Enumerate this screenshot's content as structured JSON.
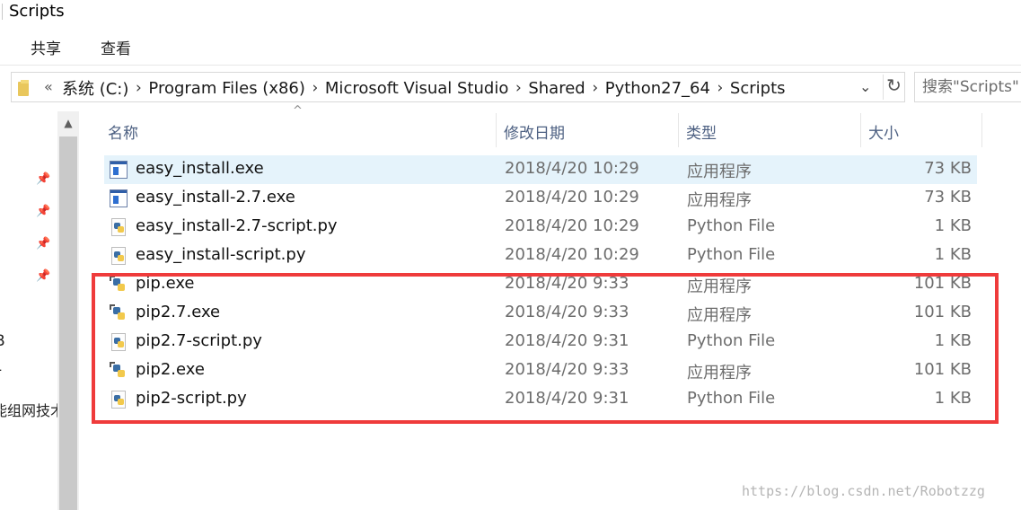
{
  "window": {
    "title": "Scripts"
  },
  "ribbon": {
    "tabs": [
      {
        "label": "共享"
      },
      {
        "label": "查看"
      }
    ]
  },
  "address": {
    "lead": "«",
    "crumbs": [
      "系统 (C:)",
      "Program Files (x86)",
      "Microsoft Visual Studio",
      "Shared",
      "Python27_64",
      "Scripts"
    ],
    "separator": "›",
    "dropdown_glyph": "⌄",
    "refresh_glyph": "↻"
  },
  "search": {
    "placeholder": "搜索\"Scripts\""
  },
  "nav": {
    "pin_glyph": "📌",
    "fragments": [
      "B",
      "-",
      "能组网技术"
    ]
  },
  "columns": {
    "name": "名称",
    "date": "修改日期",
    "type": "类型",
    "size": "大小",
    "sort_caret": "^"
  },
  "files": [
    {
      "name": "easy_install.exe",
      "date": "2018/4/20 10:29",
      "type": "应用程序",
      "size": "73 KB",
      "icon": "exe-icon",
      "selected": true
    },
    {
      "name": "easy_install-2.7.exe",
      "date": "2018/4/20 10:29",
      "type": "应用程序",
      "size": "73 KB",
      "icon": "exe-icon",
      "selected": false
    },
    {
      "name": "easy_install-2.7-script.py",
      "date": "2018/4/20 10:29",
      "type": "Python File",
      "size": "1 KB",
      "icon": "python-file-icon",
      "selected": false
    },
    {
      "name": "easy_install-script.py",
      "date": "2018/4/20 10:29",
      "type": "Python File",
      "size": "1 KB",
      "icon": "python-file-icon",
      "selected": false
    },
    {
      "name": "pip.exe",
      "date": "2018/4/20 9:33",
      "type": "应用程序",
      "size": "101 KB",
      "icon": "python-exe-icon",
      "selected": false
    },
    {
      "name": "pip2.7.exe",
      "date": "2018/4/20 9:33",
      "type": "应用程序",
      "size": "101 KB",
      "icon": "python-exe-icon",
      "selected": false
    },
    {
      "name": "pip2.7-script.py",
      "date": "2018/4/20 9:31",
      "type": "Python File",
      "size": "1 KB",
      "icon": "python-file-icon",
      "selected": false
    },
    {
      "name": "pip2.exe",
      "date": "2018/4/20 9:33",
      "type": "应用程序",
      "size": "101 KB",
      "icon": "python-exe-icon",
      "selected": false
    },
    {
      "name": "pip2-script.py",
      "date": "2018/4/20 9:31",
      "type": "Python File",
      "size": "1 KB",
      "icon": "python-file-icon",
      "selected": false
    }
  ],
  "annotation": {
    "color": "#ef3b3b"
  },
  "watermark": "https://blog.csdn.net/Robotzzg"
}
